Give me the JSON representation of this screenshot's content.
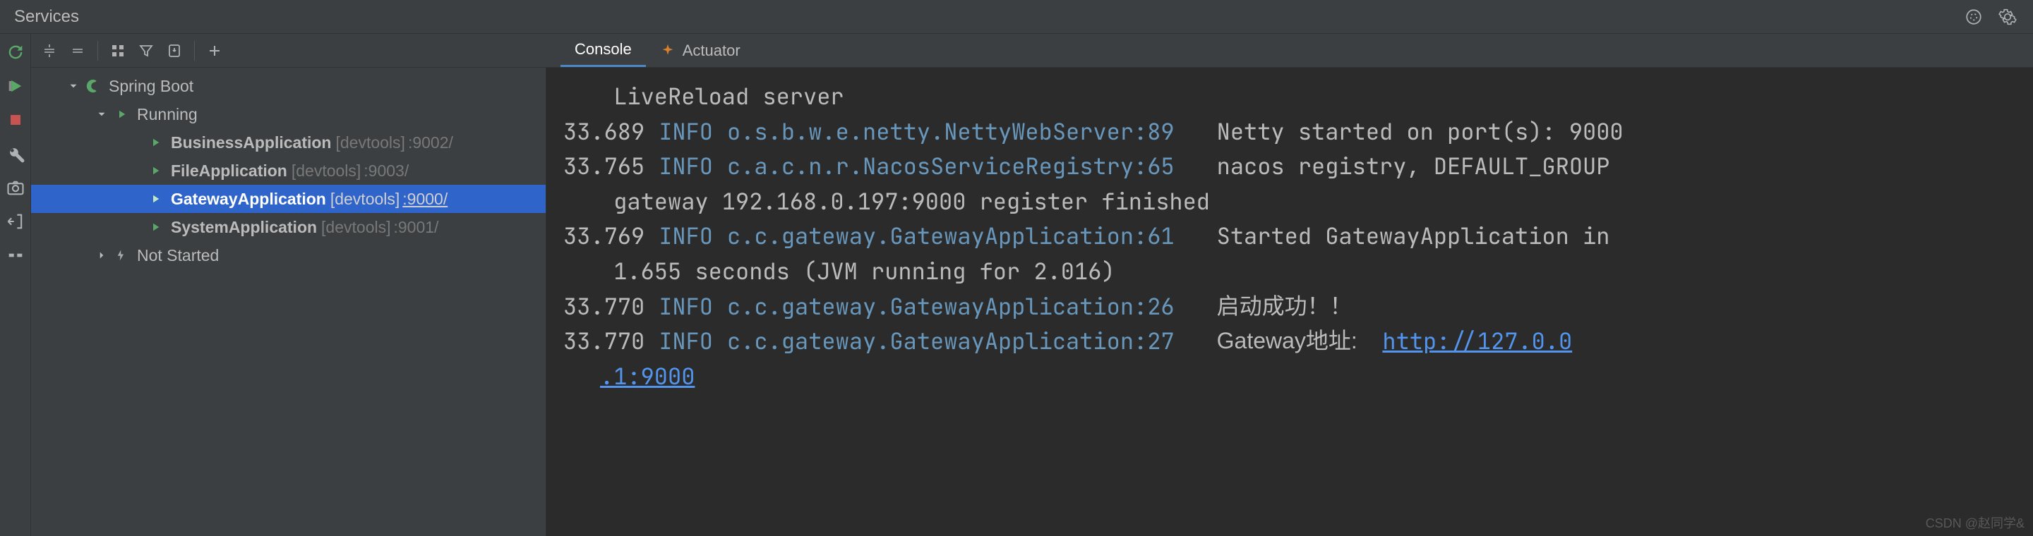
{
  "title": "Services",
  "tabs": {
    "console": "Console",
    "actuator": "Actuator"
  },
  "tree": {
    "root": "Spring Boot",
    "running": "Running",
    "not_started": "Not Started",
    "apps": [
      {
        "name": "BusinessApplication",
        "meta": "[devtools]",
        "port": ":9002/"
      },
      {
        "name": "FileApplication",
        "meta": "[devtools]",
        "port": ":9003/"
      },
      {
        "name": "GatewayApplication",
        "meta": "[devtools]",
        "port": ":9000/"
      },
      {
        "name": "SystemApplication",
        "meta": "[devtools]",
        "port": ":9001/"
      }
    ]
  },
  "console": {
    "wrap0": " LiveReload server",
    "l1_ts": "33.689",
    "l1_lvl": "INFO",
    "l1_lg": "o.s.b.w.e.netty.NettyWebServer:89",
    "l1_msg": "Netty started on port(s): 9000",
    "l2_ts": "33.765",
    "l2_lvl": "INFO",
    "l2_lg": "c.a.c.n.r.NacosServiceRegistry:65",
    "l2_msg": "nacos registry, DEFAULT_GROUP",
    "wrap2": " gateway 192.168.0.197:9000 register finished",
    "l3_ts": "33.769",
    "l3_lvl": "INFO",
    "l3_lg": "c.c.gateway.GatewayApplication:61",
    "l3_msg": "Started GatewayApplication in",
    "wrap3": " 1.655 seconds (JVM running for 2.016)",
    "l4_ts": "33.770",
    "l4_lvl": "INFO",
    "l4_lg": "c.c.gateway.GatewayApplication:26",
    "l4_msg": "启动成功！！",
    "l5_ts": "33.770",
    "l5_lvl": "INFO",
    "l5_lg": "c.c.gateway.GatewayApplication:27",
    "l5_msg_pre": "Gateway地址:    ",
    "l5_link1": "http://127.0.0",
    "wrap5": ".1:9000"
  },
  "watermark": "CSDN @赵同学&"
}
